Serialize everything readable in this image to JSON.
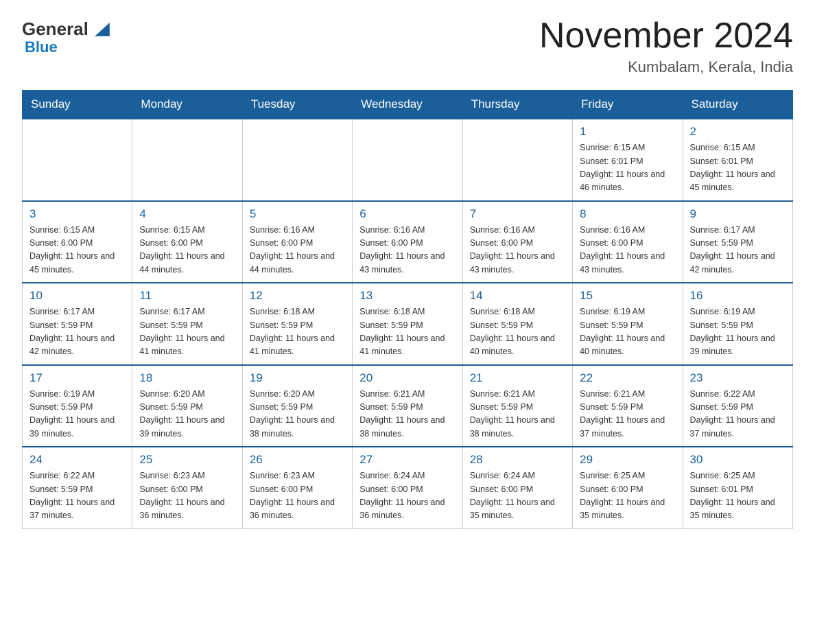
{
  "logo": {
    "general": "General",
    "blue": "Blue"
  },
  "header": {
    "month": "November 2024",
    "location": "Kumbalam, Kerala, India"
  },
  "weekdays": [
    "Sunday",
    "Monday",
    "Tuesday",
    "Wednesday",
    "Thursday",
    "Friday",
    "Saturday"
  ],
  "rows": [
    [
      {
        "day": "",
        "info": ""
      },
      {
        "day": "",
        "info": ""
      },
      {
        "day": "",
        "info": ""
      },
      {
        "day": "",
        "info": ""
      },
      {
        "day": "",
        "info": ""
      },
      {
        "day": "1",
        "info": "Sunrise: 6:15 AM\nSunset: 6:01 PM\nDaylight: 11 hours and 46 minutes."
      },
      {
        "day": "2",
        "info": "Sunrise: 6:15 AM\nSunset: 6:01 PM\nDaylight: 11 hours and 45 minutes."
      }
    ],
    [
      {
        "day": "3",
        "info": "Sunrise: 6:15 AM\nSunset: 6:00 PM\nDaylight: 11 hours and 45 minutes."
      },
      {
        "day": "4",
        "info": "Sunrise: 6:15 AM\nSunset: 6:00 PM\nDaylight: 11 hours and 44 minutes."
      },
      {
        "day": "5",
        "info": "Sunrise: 6:16 AM\nSunset: 6:00 PM\nDaylight: 11 hours and 44 minutes."
      },
      {
        "day": "6",
        "info": "Sunrise: 6:16 AM\nSunset: 6:00 PM\nDaylight: 11 hours and 43 minutes."
      },
      {
        "day": "7",
        "info": "Sunrise: 6:16 AM\nSunset: 6:00 PM\nDaylight: 11 hours and 43 minutes."
      },
      {
        "day": "8",
        "info": "Sunrise: 6:16 AM\nSunset: 6:00 PM\nDaylight: 11 hours and 43 minutes."
      },
      {
        "day": "9",
        "info": "Sunrise: 6:17 AM\nSunset: 5:59 PM\nDaylight: 11 hours and 42 minutes."
      }
    ],
    [
      {
        "day": "10",
        "info": "Sunrise: 6:17 AM\nSunset: 5:59 PM\nDaylight: 11 hours and 42 minutes."
      },
      {
        "day": "11",
        "info": "Sunrise: 6:17 AM\nSunset: 5:59 PM\nDaylight: 11 hours and 41 minutes."
      },
      {
        "day": "12",
        "info": "Sunrise: 6:18 AM\nSunset: 5:59 PM\nDaylight: 11 hours and 41 minutes."
      },
      {
        "day": "13",
        "info": "Sunrise: 6:18 AM\nSunset: 5:59 PM\nDaylight: 11 hours and 41 minutes."
      },
      {
        "day": "14",
        "info": "Sunrise: 6:18 AM\nSunset: 5:59 PM\nDaylight: 11 hours and 40 minutes."
      },
      {
        "day": "15",
        "info": "Sunrise: 6:19 AM\nSunset: 5:59 PM\nDaylight: 11 hours and 40 minutes."
      },
      {
        "day": "16",
        "info": "Sunrise: 6:19 AM\nSunset: 5:59 PM\nDaylight: 11 hours and 39 minutes."
      }
    ],
    [
      {
        "day": "17",
        "info": "Sunrise: 6:19 AM\nSunset: 5:59 PM\nDaylight: 11 hours and 39 minutes."
      },
      {
        "day": "18",
        "info": "Sunrise: 6:20 AM\nSunset: 5:59 PM\nDaylight: 11 hours and 39 minutes."
      },
      {
        "day": "19",
        "info": "Sunrise: 6:20 AM\nSunset: 5:59 PM\nDaylight: 11 hours and 38 minutes."
      },
      {
        "day": "20",
        "info": "Sunrise: 6:21 AM\nSunset: 5:59 PM\nDaylight: 11 hours and 38 minutes."
      },
      {
        "day": "21",
        "info": "Sunrise: 6:21 AM\nSunset: 5:59 PM\nDaylight: 11 hours and 38 minutes."
      },
      {
        "day": "22",
        "info": "Sunrise: 6:21 AM\nSunset: 5:59 PM\nDaylight: 11 hours and 37 minutes."
      },
      {
        "day": "23",
        "info": "Sunrise: 6:22 AM\nSunset: 5:59 PM\nDaylight: 11 hours and 37 minutes."
      }
    ],
    [
      {
        "day": "24",
        "info": "Sunrise: 6:22 AM\nSunset: 5:59 PM\nDaylight: 11 hours and 37 minutes."
      },
      {
        "day": "25",
        "info": "Sunrise: 6:23 AM\nSunset: 6:00 PM\nDaylight: 11 hours and 36 minutes."
      },
      {
        "day": "26",
        "info": "Sunrise: 6:23 AM\nSunset: 6:00 PM\nDaylight: 11 hours and 36 minutes."
      },
      {
        "day": "27",
        "info": "Sunrise: 6:24 AM\nSunset: 6:00 PM\nDaylight: 11 hours and 36 minutes."
      },
      {
        "day": "28",
        "info": "Sunrise: 6:24 AM\nSunset: 6:00 PM\nDaylight: 11 hours and 35 minutes."
      },
      {
        "day": "29",
        "info": "Sunrise: 6:25 AM\nSunset: 6:00 PM\nDaylight: 11 hours and 35 minutes."
      },
      {
        "day": "30",
        "info": "Sunrise: 6:25 AM\nSunset: 6:01 PM\nDaylight: 11 hours and 35 minutes."
      }
    ]
  ]
}
